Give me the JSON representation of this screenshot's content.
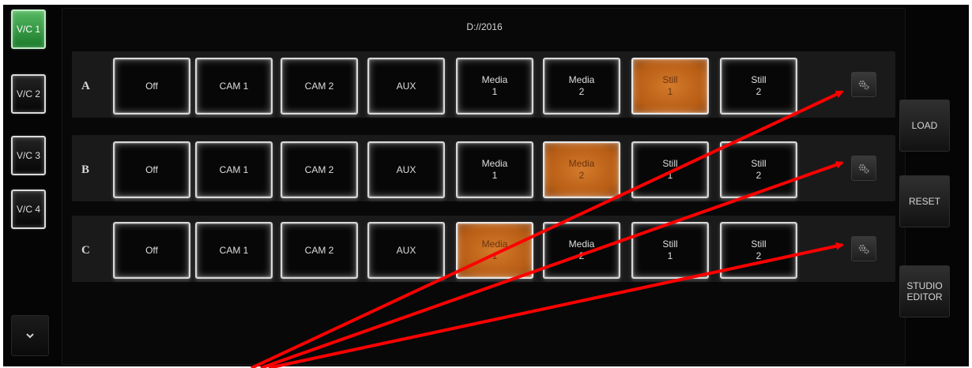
{
  "header": {
    "path": "D://2016"
  },
  "vc_buttons": [
    {
      "label": "V/C 1",
      "active": true
    },
    {
      "label": "V/C 2",
      "active": false
    },
    {
      "label": "V/C 3",
      "active": false
    },
    {
      "label": "V/C 4",
      "active": false
    }
  ],
  "scroll_down_icon": "chevron-down-icon",
  "rows": [
    {
      "label": "A",
      "sources": [
        "Off",
        "CAM 1",
        "CAM 2",
        "AUX",
        "Media\n1",
        "Media\n2",
        "Still\n1",
        "Still\n2"
      ],
      "selected": 6,
      "settings_icon": "gear-icon"
    },
    {
      "label": "B",
      "sources": [
        "Off",
        "CAM 1",
        "CAM 2",
        "AUX",
        "Media\n1",
        "Media\n2",
        "Still\n1",
        "Still\n2"
      ],
      "selected": 5,
      "settings_icon": "gear-icon"
    },
    {
      "label": "C",
      "sources": [
        "Off",
        "CAM 1",
        "CAM 2",
        "AUX",
        "Media\n1",
        "Media\n2",
        "Still\n1",
        "Still\n2"
      ],
      "selected": 4,
      "settings_icon": "gear-icon"
    }
  ],
  "side": {
    "load": "LOAD",
    "reset": "RESET",
    "studio_editor": "STUDIO\nEDITOR"
  },
  "colors": {
    "active_green": "#2f9b3d",
    "selected_orange": "#c96b1f",
    "arrow_red": "#ff0000"
  }
}
